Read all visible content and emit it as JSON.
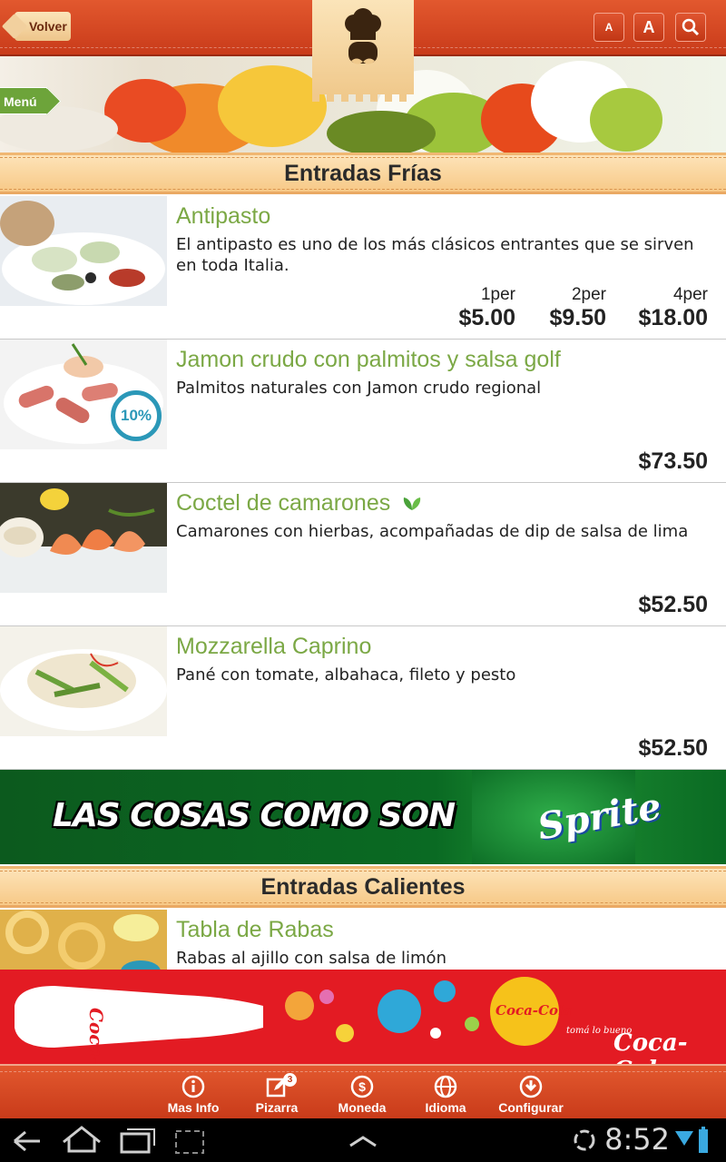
{
  "header": {
    "back_label": "Volver",
    "font_small_label": "A",
    "font_large_label": "A",
    "search_icon": "search-icon",
    "logo_icon": "chef-icon"
  },
  "hero": {
    "menu_label": "Menú"
  },
  "sections": [
    {
      "title": "Entradas Frías"
    },
    {
      "title": "Entradas Calientes"
    }
  ],
  "items": [
    {
      "name": "Antipasto",
      "desc": "El antipasto es uno de los más clásicos entrantes que se sirven en toda Italia.",
      "prices": [
        {
          "label": "1per",
          "value": "$5.00"
        },
        {
          "label": "2per",
          "value": "$9.50"
        },
        {
          "label": "4per",
          "value": "$18.00"
        }
      ]
    },
    {
      "name": "Jamon crudo con palmitos y salsa golf",
      "desc": "Palmitos naturales con Jamon crudo regional",
      "price": "$73.50",
      "discount": "10%"
    },
    {
      "name": "Coctel de camarones",
      "desc": "Camarones con hierbas, acompañadas de dip de salsa de lima",
      "price": "$52.50",
      "icon": "leaf-icon"
    },
    {
      "name": "Mozzarella Caprino",
      "desc": "Pané con tomate, albahaca, fileto y pesto",
      "price": "$52.50"
    },
    {
      "name": "Tabla de Rabas",
      "desc": "Rabas al ajillo con salsa de limón"
    }
  ],
  "ads": {
    "sprite_slogan": "LAS COSAS COMO SON",
    "sprite_brand": "Sprite",
    "coke_brand": "Coca-Cola",
    "coke_tagline": "tomá lo bueno"
  },
  "bottom_nav": [
    {
      "label": "Mas Info",
      "icon": "info-icon"
    },
    {
      "label": "Pizarra",
      "icon": "edit-icon",
      "badge": "3"
    },
    {
      "label": "Moneda",
      "icon": "currency-icon"
    },
    {
      "label": "Idioma",
      "icon": "globe-icon"
    },
    {
      "label": "Configurar",
      "icon": "download-icon"
    }
  ],
  "system": {
    "time": "8:52"
  },
  "colors": {
    "accent": "#d2461f",
    "item_title": "#7ba845",
    "section_bg": "#f9d29c"
  }
}
